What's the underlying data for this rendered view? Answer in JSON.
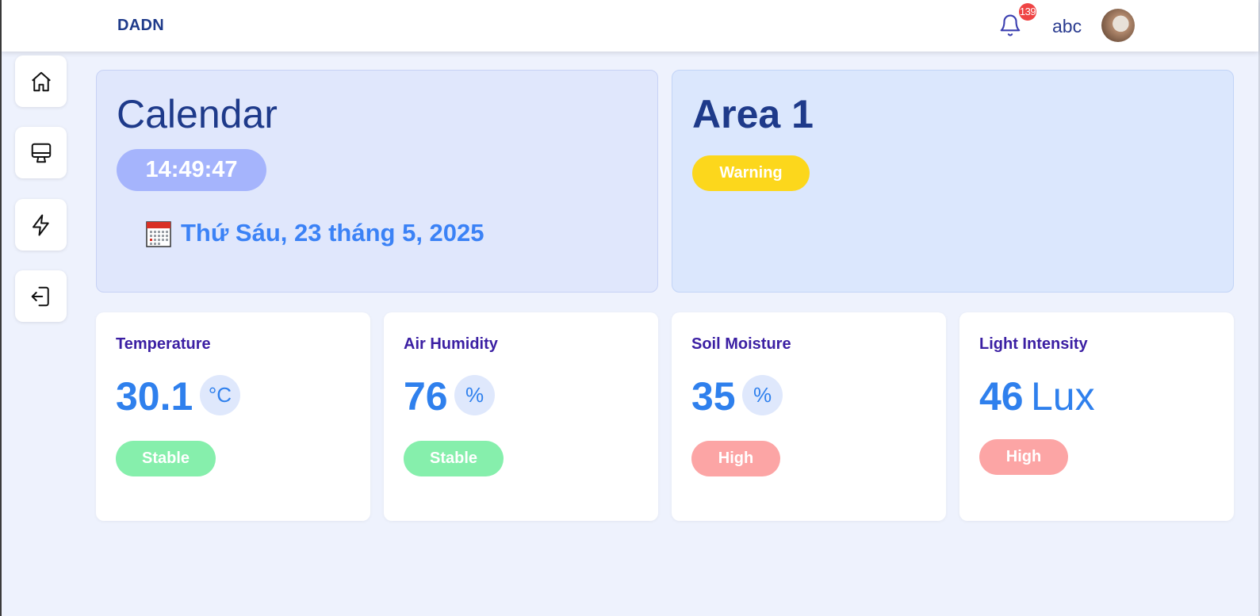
{
  "header": {
    "brand": "DADN",
    "notification_count": "139",
    "username": "abc"
  },
  "sidebar": {
    "items": [
      {
        "icon": "home-icon"
      },
      {
        "icon": "monitor-icon"
      },
      {
        "icon": "lightning-icon"
      },
      {
        "icon": "logout-icon"
      }
    ]
  },
  "calendar": {
    "title": "Calendar",
    "time": "14:49:47",
    "date": "Thứ Sáu, 23 tháng 5, 2025"
  },
  "area": {
    "title": "Area 1",
    "status": "Warning"
  },
  "metrics": [
    {
      "title": "Temperature",
      "value": "30.1",
      "unit": "°C",
      "status": "Stable"
    },
    {
      "title": "Air Humidity",
      "value": "76",
      "unit": "%",
      "status": "Stable"
    },
    {
      "title": "Soil Moisture",
      "value": "35",
      "unit": "%",
      "status": "High"
    },
    {
      "title": "Light Intensity",
      "value": "46",
      "unit": "Lux",
      "status": "High"
    }
  ],
  "colors": {
    "accent": "#2f80ed",
    "dark_blue": "#1e3a8a",
    "stable": "#86efac",
    "high": "#fca5a5",
    "warning": "#fcd71c",
    "badge": "#ef4444"
  }
}
